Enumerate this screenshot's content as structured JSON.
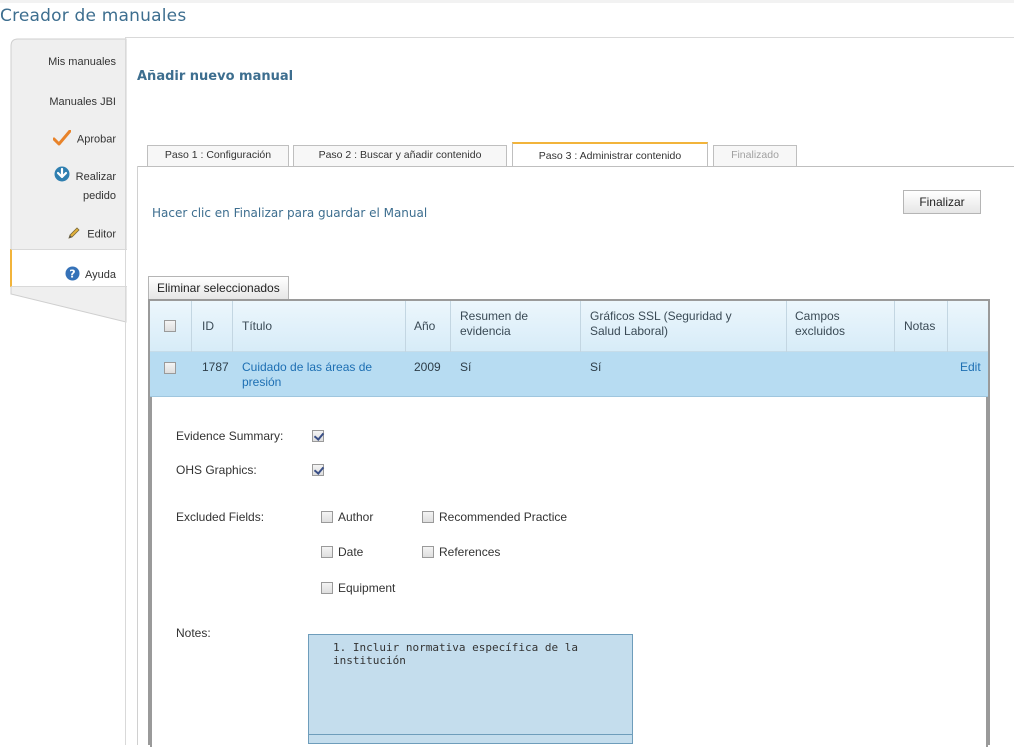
{
  "app": {
    "title": "Creador de manuales"
  },
  "nav": {
    "items": [
      {
        "label": "Mis manuales"
      },
      {
        "label": "Manuales JBI"
      },
      {
        "label": "Aprobar"
      },
      {
        "label_line1": "Realizar",
        "label_line2": "pedido"
      },
      {
        "label": "Editor"
      },
      {
        "label": "Ayuda"
      }
    ],
    "active": "Editor"
  },
  "section": {
    "title": "Añadir nuevo manual"
  },
  "tabs": [
    {
      "label": "Paso 1 : Configuración",
      "state": "normal"
    },
    {
      "label": "Paso 2 : Buscar y añadir contenido",
      "state": "normal"
    },
    {
      "label": "Paso 3 : Administrar contenido",
      "state": "active"
    },
    {
      "label": "Finalizado",
      "state": "disabled"
    }
  ],
  "step3": {
    "instruction": "Hacer clic en Finalizar para guardar el Manual",
    "finish_label": "Finalizar",
    "delete_selected_label": "Eliminar seleccionados"
  },
  "grid": {
    "columns": {
      "id": "ID",
      "title": "Título",
      "year": "Año",
      "summary_1": "Resumen de",
      "summary_2": "evidencia",
      "graphics_1": "Gráficos SSL (Seguridad y",
      "graphics_2": "Salud Laboral)",
      "excluded_1": "Campos",
      "excluded_2": "excluidos",
      "notes": "Notas"
    },
    "rows": [
      {
        "id": "1787",
        "title_1": "Cuidado de las áreas de",
        "title_2": "presión",
        "year": "2009",
        "summary": "Sí",
        "graphics": "Sí",
        "excluded": "",
        "notes": "",
        "edit_label": "Edit"
      }
    ]
  },
  "detail": {
    "evidence_summary_label": "Evidence Summary:",
    "evidence_summary_checked": true,
    "ohs_graphics_label": "OHS Graphics:",
    "ohs_graphics_checked": true,
    "excluded_fields_label": "Excluded Fields:",
    "fields": {
      "author": "Author",
      "recommended_practice": "Recommended Practice",
      "date": "Date",
      "references": "References",
      "equipment": "Equipment"
    },
    "notes_label": "Notes:",
    "notes_text": "1. Incluir normativa específica de la institución"
  },
  "colors": {
    "accent": "#f2b43b",
    "title_blue": "#3d6e8f",
    "row_highlight": "#b7dcf2",
    "link": "#1d6fb3"
  },
  "icons": {
    "approve": "checkmark-icon",
    "order": "download-arrow-icon",
    "editor": "pencil-icon",
    "help": "help-icon"
  }
}
